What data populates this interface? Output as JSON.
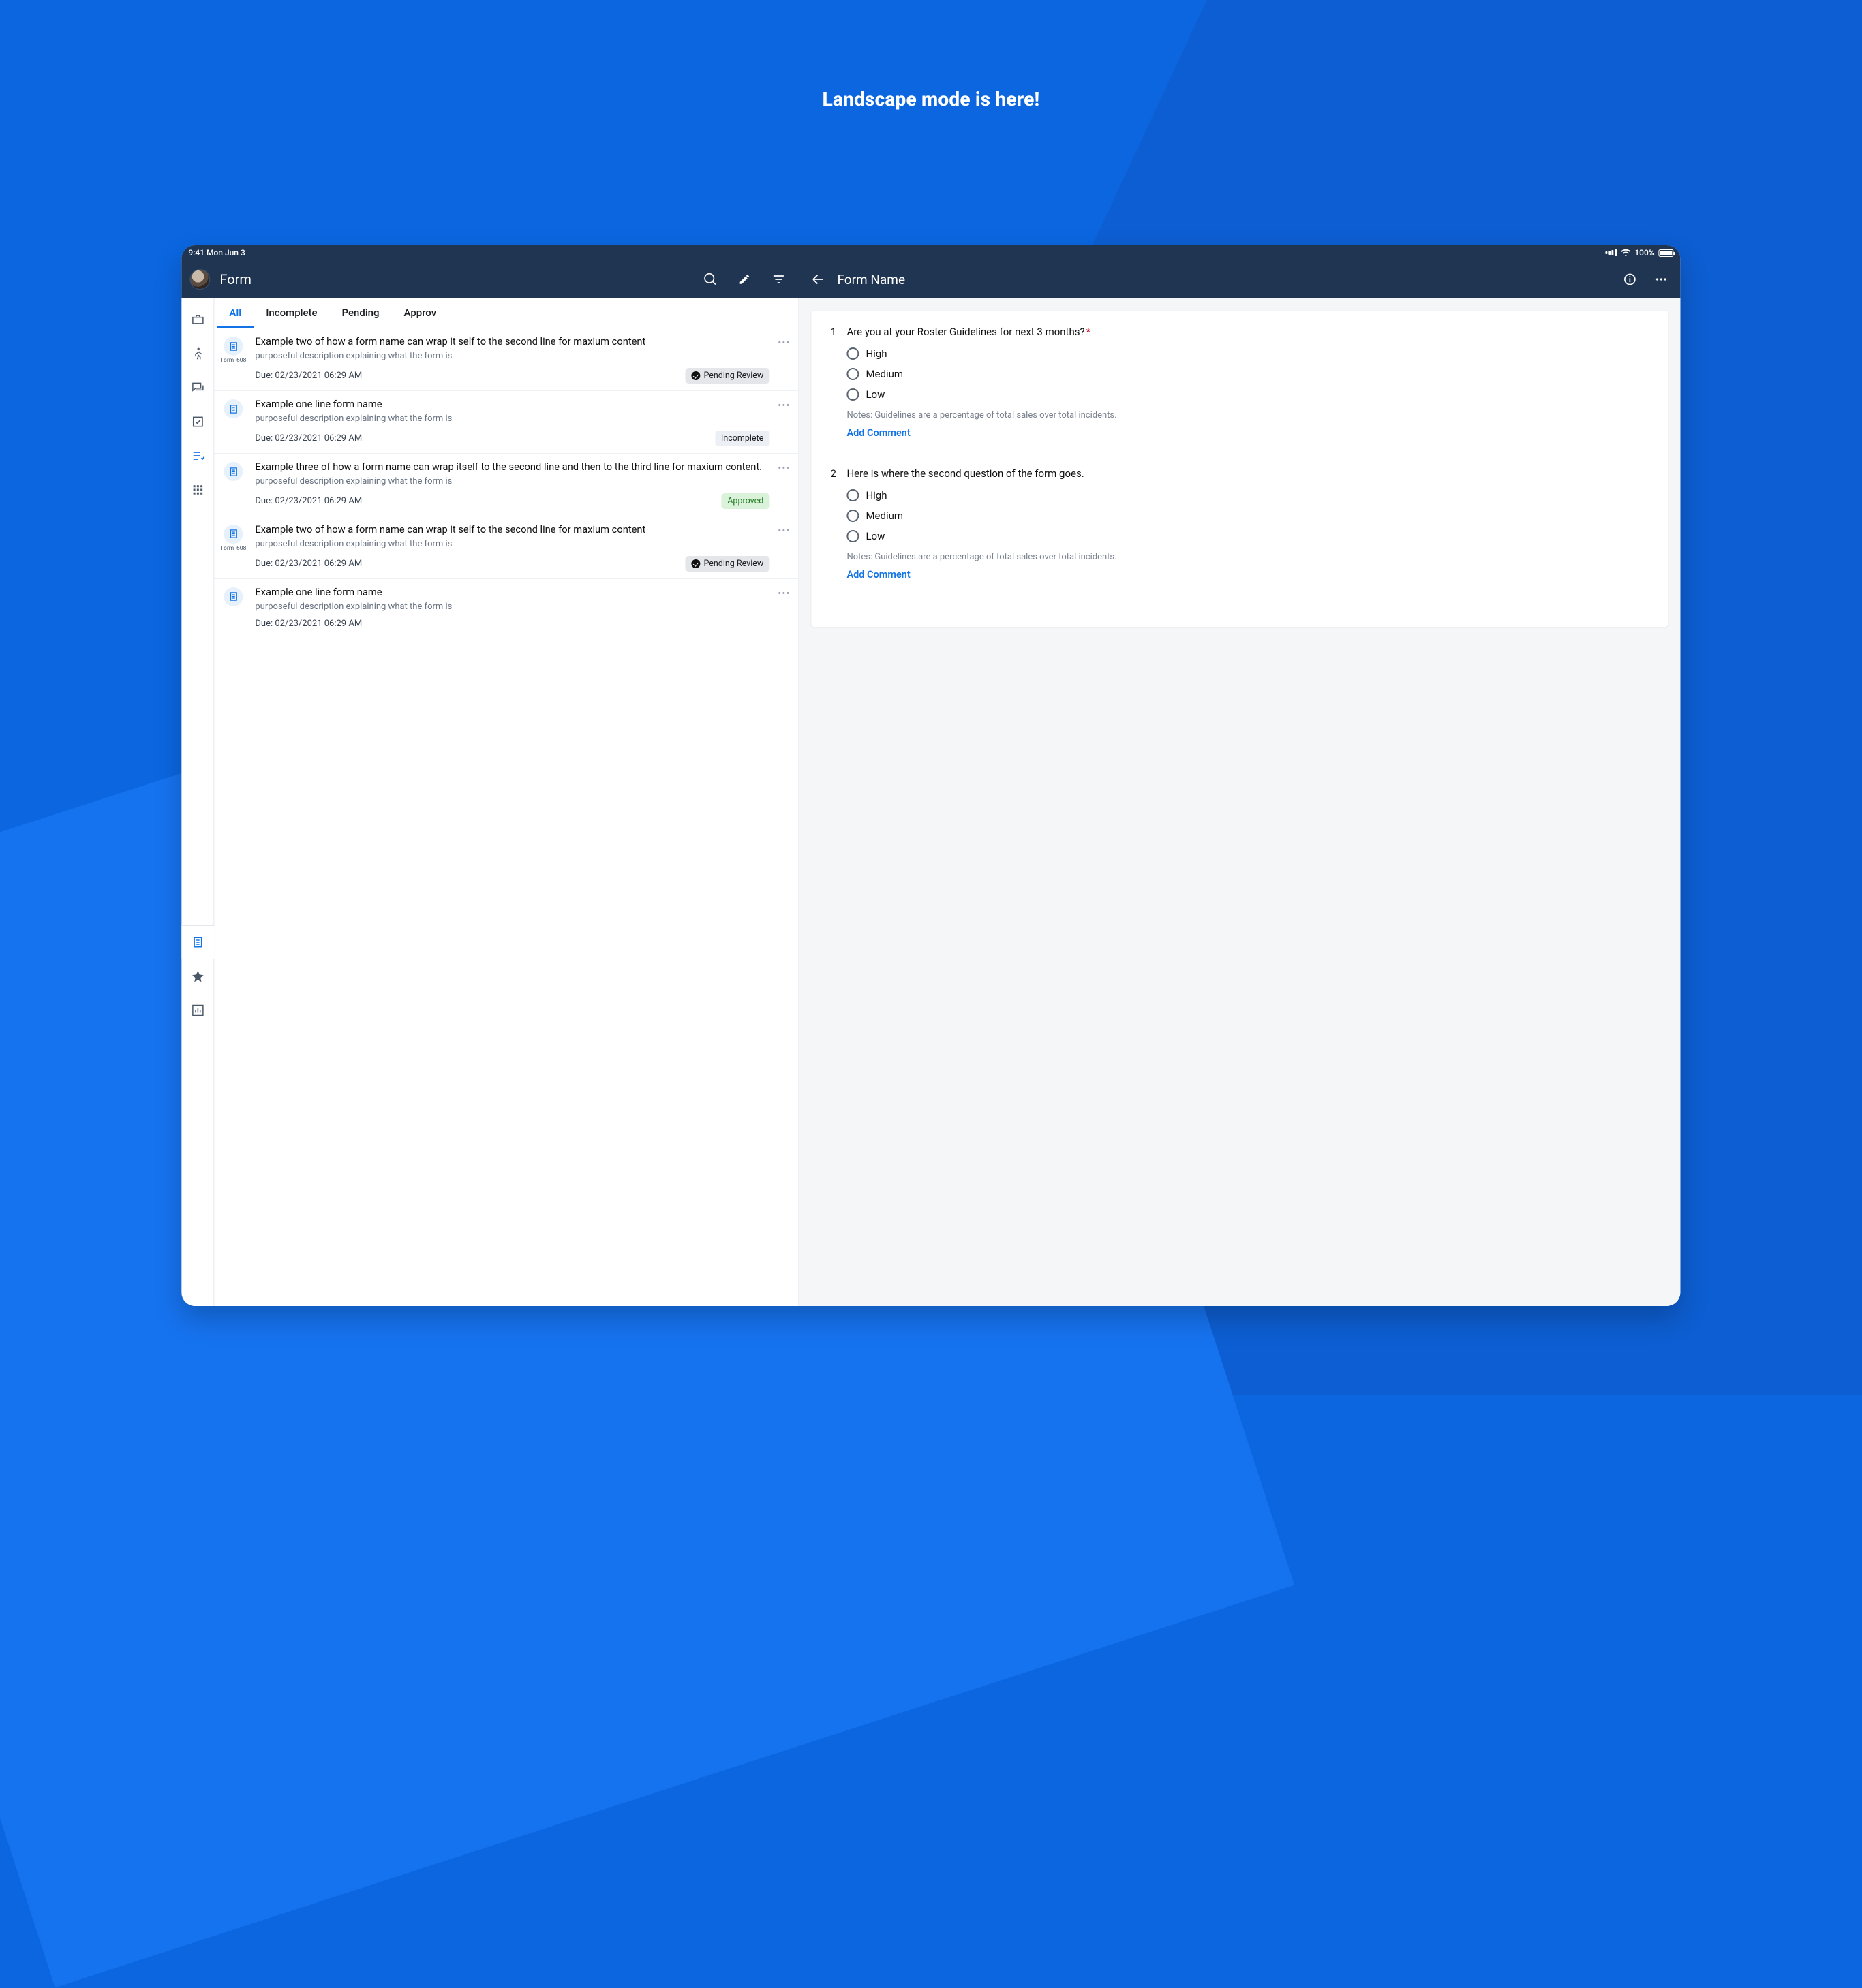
{
  "hero": "Landscape mode is here!",
  "statusbar": {
    "time": "9:41  Mon Jun 3",
    "battery": "100%"
  },
  "appbar": {
    "title_left": "Form",
    "title_right": "Form Name"
  },
  "tabs": [
    {
      "label": "All",
      "active": true
    },
    {
      "label": "Incomplete",
      "active": false
    },
    {
      "label": "Pending",
      "active": false
    },
    {
      "label": "Approv",
      "active": false
    }
  ],
  "forms": [
    {
      "id": "Form_608",
      "title": "Example two of how a form name can wrap it self to the  second line for maxium content",
      "desc": "purposeful description explaining what the form is",
      "due": "Due: 02/23/2021 06:29 AM",
      "status": "Pending Review",
      "status_kind": "pending"
    },
    {
      "id": "",
      "title": "Example one line form name",
      "desc": "purposeful description explaining what the form is",
      "due": "Due: 02/23/2021 06:29 AM",
      "status": "Incomplete",
      "status_kind": "incomplete"
    },
    {
      "id": "",
      "title": "Example three of how a form name can wrap itself to the second line and then to the third line for maxium content.",
      "desc": "purposeful description explaining what the form is",
      "due": "Due: 02/23/2021 06:29 AM",
      "status": "Approved",
      "status_kind": "approved"
    },
    {
      "id": "Form_608",
      "title": "Example two of how a form name can wrap it self to the  second line for maxium content",
      "desc": "purposeful description explaining what the form is",
      "due": "Due: 02/23/2021 06:29 AM",
      "status": "Pending Review",
      "status_kind": "pending"
    },
    {
      "id": "",
      "title": "Example one line form name",
      "desc": "purposeful description explaining what the form is",
      "due": "Due: 02/23/2021 06:29 AM",
      "status": "",
      "status_kind": ""
    }
  ],
  "questions": [
    {
      "num": "1",
      "text": "Are you at your Roster Guidelines for next 3 months?",
      "required": true,
      "options": [
        "High",
        "Medium",
        "Low"
      ],
      "notes": "Notes: Guidelines are a percentage of total sales over total incidents.",
      "add_comment": "Add Comment"
    },
    {
      "num": "2",
      "text": "Here is where the second question of the form goes.",
      "required": false,
      "options": [
        "High",
        "Medium",
        "Low"
      ],
      "notes": "Notes: Guidelines are a percentage of total sales over total incidents.",
      "add_comment": "Add Comment"
    }
  ],
  "rail_icons": [
    "briefcase",
    "walk",
    "chat",
    "checkbox",
    "tasks",
    "apps",
    "document",
    "star",
    "chart"
  ]
}
